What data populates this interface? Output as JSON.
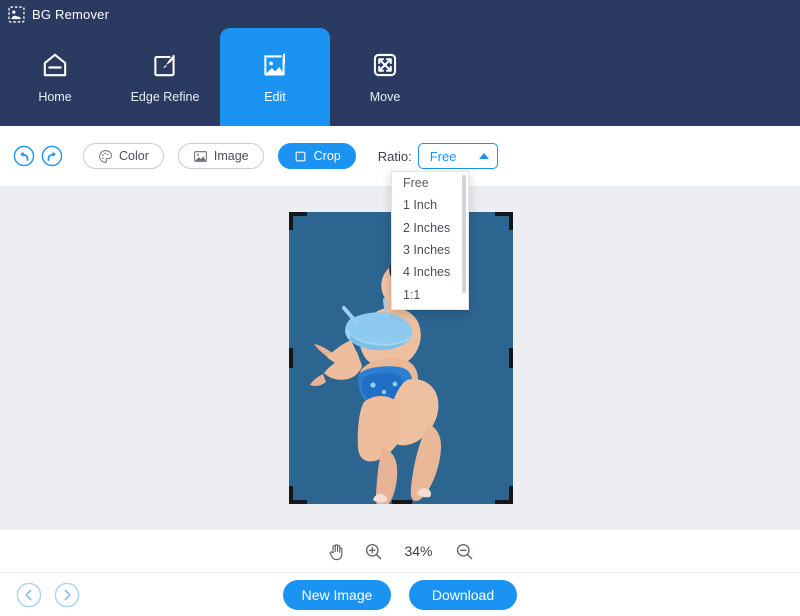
{
  "window": {
    "title": "BG Remover",
    "logo_icon": "bg-remover-logo-icon"
  },
  "nav": {
    "tabs": [
      {
        "label": "Home",
        "icon": "home-icon",
        "active": false
      },
      {
        "label": "Edge Refine",
        "icon": "edge-refine-icon",
        "active": false
      },
      {
        "label": "Edit",
        "icon": "edit-image-icon",
        "active": true
      },
      {
        "label": "Move",
        "icon": "move-icon",
        "active": false
      }
    ]
  },
  "toolbar": {
    "undo_icon": "undo-icon",
    "redo_icon": "redo-icon",
    "color_label": "Color",
    "color_icon": "palette-icon",
    "image_label": "Image",
    "image_icon": "picture-icon",
    "crop_label": "Crop",
    "crop_icon": "crop-icon",
    "ratio_label": "Ratio:",
    "ratio_value": "Free",
    "ratio_caret_icon": "chevron-up-icon"
  },
  "ratio_menu": {
    "open": true,
    "selected": "Free",
    "options": [
      "Free",
      "1 Inch",
      "2 Inches",
      "3 Inches",
      "4 Inches",
      "1:1"
    ]
  },
  "canvas": {
    "image_alt": "child-photo-blue-background",
    "background_color": "#eceef1",
    "photo_background_color": "#2d6591",
    "crop_handles": 8
  },
  "zoombar": {
    "hand_icon": "hand-tool-icon",
    "zoom_in_icon": "zoom-in-icon",
    "zoom_out_icon": "zoom-out-icon",
    "zoom_level": "34%"
  },
  "bottombar": {
    "prev_icon": "chevron-left-circle-icon",
    "next_icon": "chevron-right-circle-icon",
    "new_image_label": "New Image",
    "download_label": "Download"
  },
  "colors": {
    "navy": "#2b3a60",
    "accent_blue": "#1b93f2",
    "canvas_gray": "#eceef1",
    "photo_blue": "#2d6591"
  }
}
